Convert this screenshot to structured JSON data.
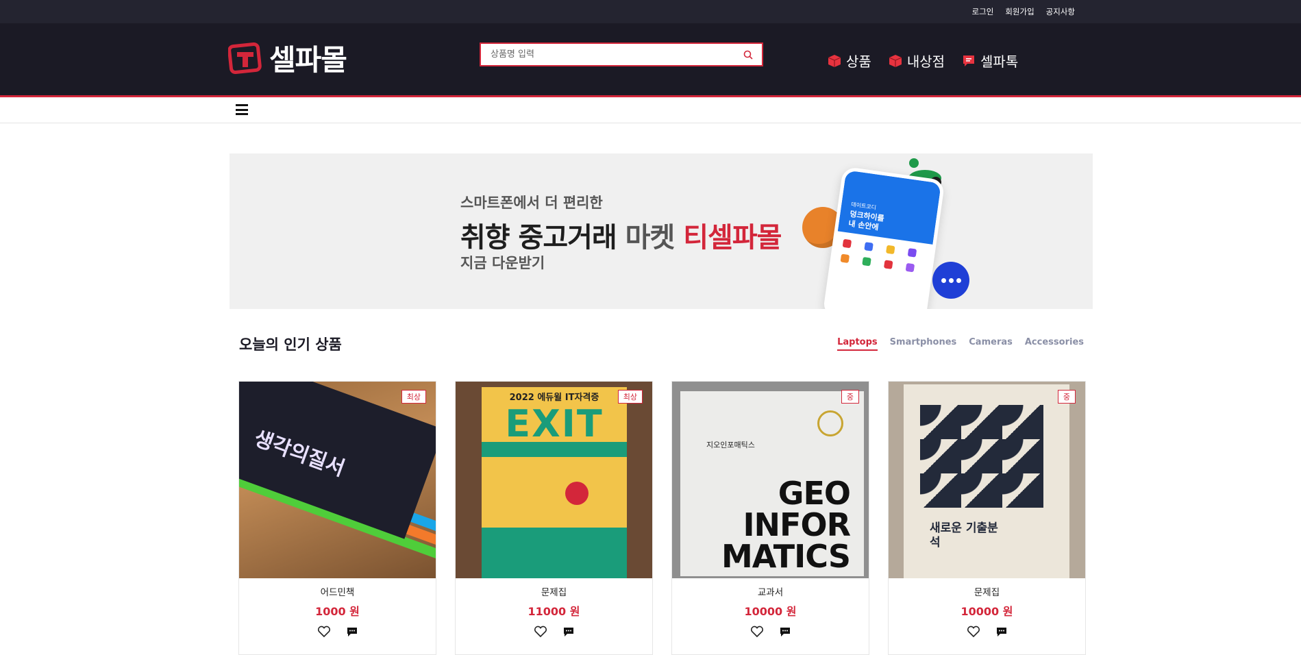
{
  "topbar": {
    "login": "로그인",
    "signup": "회원가입",
    "notice": "공지사항"
  },
  "header": {
    "logo_text": "셀파몰",
    "search_placeholder": "상품명 입력",
    "nav": [
      {
        "label": "상품",
        "icon": "box-icon"
      },
      {
        "label": "내상점",
        "icon": "store-icon"
      },
      {
        "label": "셀파톡",
        "icon": "chat-icon"
      }
    ]
  },
  "banner": {
    "line1": "스마트폰에서 더 편리한",
    "line2_a": "취향 중고거래",
    "line2_b": "마켓",
    "line2_c": "티셀파몰",
    "line3": "지금 다운받기",
    "phone_text_1": "데이트코디",
    "phone_text_2": "덩크하이를",
    "phone_text_3": "내 손안에"
  },
  "section": {
    "title": "오늘의 인기 상품",
    "tabs": [
      "Laptops",
      "Smartphones",
      "Cameras",
      "Accessories"
    ],
    "active_tab": "Laptops"
  },
  "products": [
    {
      "name": "어드민책",
      "price": "1000 원",
      "badge": "최상",
      "cover": "생각의질서"
    },
    {
      "name": "문제집",
      "price": "11000 원",
      "badge": "최상",
      "cover": "EXIT",
      "cover_top": "2022 에듀윌 IT자격증"
    },
    {
      "name": "교과서",
      "price": "10000 원",
      "badge": "중",
      "cover": "GEO INFOR MATICS",
      "cover_sub": "지오인포매틱스"
    },
    {
      "name": "문제집",
      "price": "10000 원",
      "badge": "중",
      "cover": "새로운 기출분석"
    }
  ],
  "colors": {
    "accent": "#d3263a",
    "header_bg": "#1b1a25",
    "topbar_bg": "#242430",
    "tab_inactive": "#8a8fa6"
  }
}
